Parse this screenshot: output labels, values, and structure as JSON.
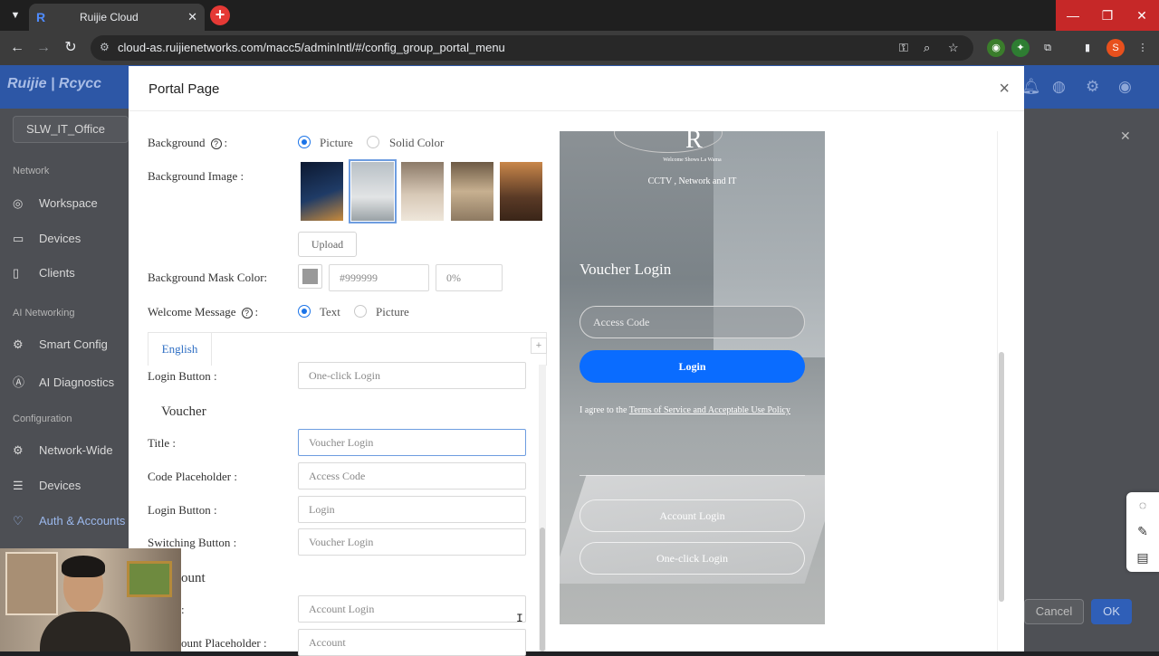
{
  "browser": {
    "tab_title": "Ruijie Cloud",
    "url": "cloud-as.ruijienetworks.com/macc5/adminIntl/#/config_group_portal_menu",
    "profile_initial": "S"
  },
  "app": {
    "logo_text": "Ruijie | Rcycc",
    "project": "SLW_IT_Office",
    "sections": {
      "network": "Network",
      "ai": "AI Networking",
      "config": "Configuration"
    },
    "nav": {
      "workspace": "Workspace",
      "devices": "Devices",
      "clients": "Clients",
      "smart_config": "Smart Config",
      "ai_diagnostics": "AI Diagnostics",
      "network_wide": "Network-Wide",
      "config_devices": "Devices",
      "auth_accounts": "Auth & Accounts"
    },
    "cancel": "Cancel",
    "ok": "OK"
  },
  "modal": {
    "title": "Portal Page",
    "background_label": "Background",
    "bg_options": {
      "picture": "Picture",
      "solid": "Solid Color"
    },
    "bg_image_label": "Background Image",
    "upload": "Upload",
    "mask_label": "Background Mask Color",
    "mask_color": "#999999",
    "mask_opacity": "0%",
    "welcome_label": "Welcome Message",
    "welcome_options": {
      "text": "Text",
      "picture": "Picture"
    },
    "tab_english": "English",
    "tab_add": "+",
    "rows": {
      "login_button_top_label": "Login Button",
      "login_button_top_value": "One-click Login",
      "voucher_heading": "Voucher",
      "title_label": "Title",
      "title_value": "Voucher Login",
      "code_ph_label": "Code Placeholder",
      "code_ph_value": "Access Code",
      "login_btn_label": "Login Button",
      "login_btn_value": "Login",
      "switch_label": "Switching Button",
      "switch_value": "Voucher Login",
      "account_heading": "ount",
      "account_title_value": "Account Login",
      "account_ph_label": "ount Placeholder",
      "account_ph_value": "Account"
    }
  },
  "preview": {
    "logo": "R",
    "welcome": "Welcome Shows La Wama",
    "subtitle": "CCTV , Network and IT",
    "title": "Voucher Login",
    "input_placeholder": "Access Code",
    "login": "Login",
    "terms_prefix": "I agree to the ",
    "terms_link": "Terms of Service and Acceptable Use Policy",
    "account_login": "Account Login",
    "oneclick_login": "One-click Login"
  }
}
